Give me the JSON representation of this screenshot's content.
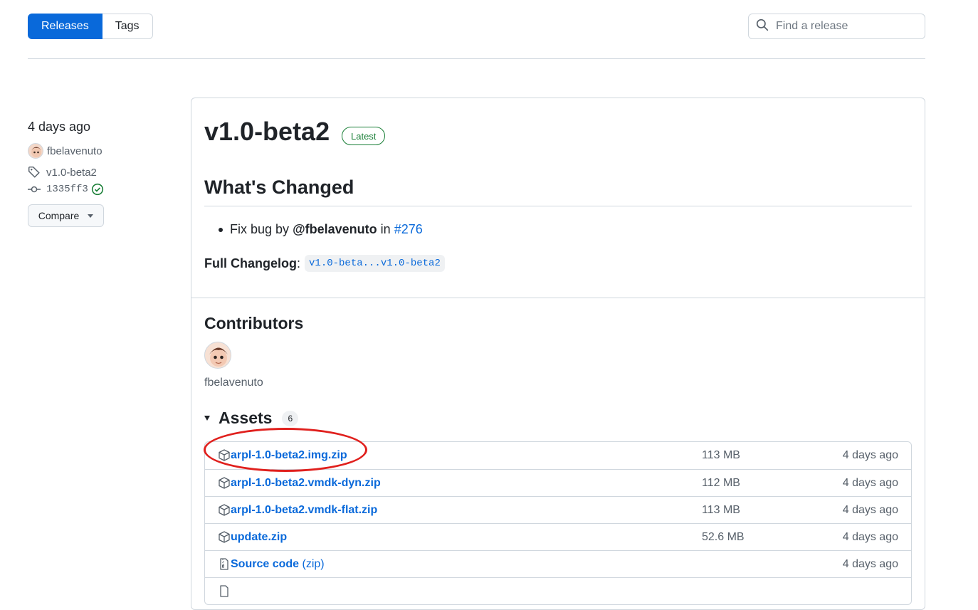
{
  "tabs": [
    {
      "label": "Releases",
      "selected": true
    },
    {
      "label": "Tags",
      "selected": false
    }
  ],
  "search": {
    "placeholder": "Find a release"
  },
  "meta": {
    "date": "4 days ago",
    "author": "fbelavenuto",
    "tag": "v1.0-beta2",
    "commit": "1335ff3",
    "compare_label": "Compare"
  },
  "release": {
    "title": "v1.0-beta2",
    "badge": "Latest",
    "whats_changed_heading": "What's Changed",
    "change_item": {
      "prefix": "Fix bug by",
      "user": "@fbelavenuto",
      "in": "in",
      "pr": "#276"
    },
    "changelog_label": "Full Changelog",
    "changelog_colon": ":",
    "changelog_link": "v1.0-beta...v1.0-beta2"
  },
  "contributors": {
    "heading": "Contributors",
    "names": [
      "fbelavenuto"
    ]
  },
  "assets": {
    "heading": "Assets",
    "count": "6",
    "items": [
      {
        "name": "arpl-1.0-beta2.img.zip",
        "size": "113 MB",
        "date": "4 days ago",
        "icon": "package-icon"
      },
      {
        "name": "arpl-1.0-beta2.vmdk-dyn.zip",
        "size": "112 MB",
        "date": "4 days ago",
        "icon": "package-icon"
      },
      {
        "name": "arpl-1.0-beta2.vmdk-flat.zip",
        "size": "113 MB",
        "date": "4 days ago",
        "icon": "package-icon"
      },
      {
        "name": "update.zip",
        "size": "52.6 MB",
        "date": "4 days ago",
        "icon": "package-icon"
      },
      {
        "name": "Source code",
        "suffix": "(zip)",
        "size": "",
        "date": "4 days ago",
        "icon": "file-zip-icon"
      }
    ]
  },
  "colors": {
    "accent": "#0969da",
    "latest_badge": "#1a7f37",
    "annotation_oval": "#e0201d"
  }
}
